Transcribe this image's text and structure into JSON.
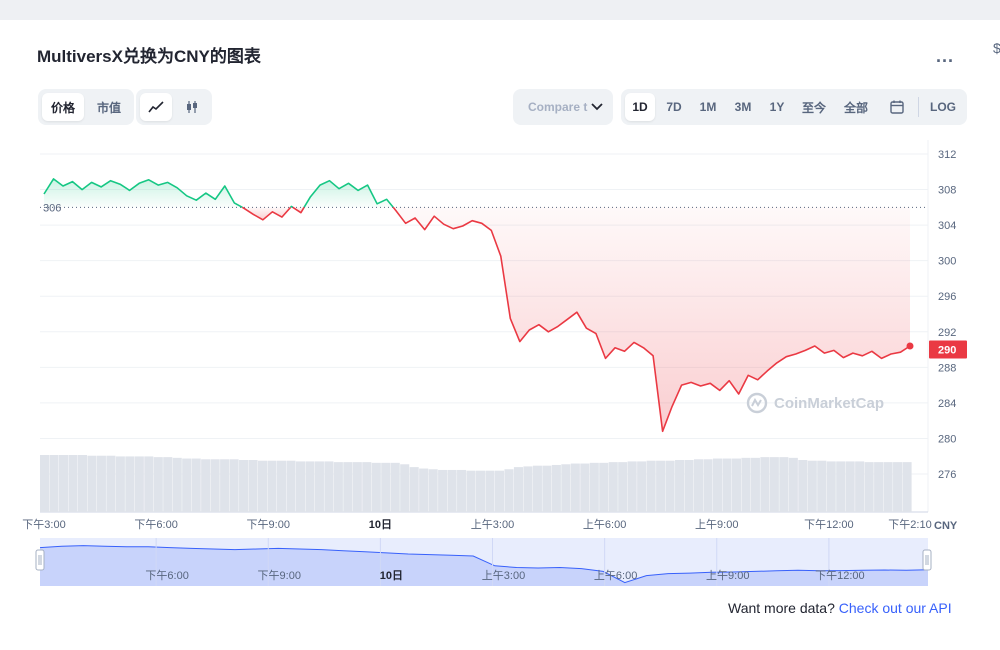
{
  "header": {
    "title": "MultiversX兑换为CNY的图表",
    "more_label": "...",
    "edge_char": "$"
  },
  "toolbar": {
    "view_tabs": [
      "价格",
      "市值"
    ],
    "chart_style": [
      "line-icon",
      "candlestick-icon"
    ],
    "compare_placeholder": "Compare t",
    "ranges": [
      "1D",
      "7D",
      "1M",
      "3M",
      "1Y",
      "至今",
      "全部"
    ],
    "calendar_icon": "calendar-icon",
    "log_label": "LOG"
  },
  "colors": {
    "up": "#16c784",
    "down": "#ea3943",
    "accent": "#3861fb"
  },
  "chart_data": {
    "type": "line",
    "currency_label": "CNY",
    "reference_line_value": 306,
    "last_value_label": "290",
    "ylim": [
      272,
      314
    ],
    "y_ticks": [
      312,
      308,
      304,
      300,
      296,
      292,
      288,
      284,
      280,
      276
    ],
    "x_ticks": [
      "下午3:00",
      "下午6:00",
      "下午9:00",
      "10日",
      "上午3:00",
      "上午6:00",
      "上午9:00",
      "下午12:00",
      "下午2:10"
    ],
    "navigator_ticks": [
      "下午6:00",
      "下午9:00",
      "10日",
      "上午3:00",
      "上午6:00",
      "上午9:00",
      "下午12:00"
    ],
    "x_hours": [
      0,
      3,
      6,
      9,
      12,
      15,
      18,
      21,
      23.17
    ],
    "series": [
      {
        "values": [
          307.5,
          309.2,
          308.4,
          308.9,
          308.0,
          308.8,
          308.3,
          309.0,
          308.6,
          307.9,
          308.7,
          309.1,
          308.5,
          308.8,
          308.2,
          307.3,
          306.8,
          307.6,
          306.9,
          308.4,
          306.5,
          305.9,
          305.2,
          304.6,
          305.5,
          304.9,
          306.1,
          305.4,
          307.2,
          308.5,
          309.0,
          308.1,
          308.7,
          307.9,
          308.5,
          306.4,
          306.9,
          305.6,
          304.2,
          304.8,
          303.5,
          305.0,
          304.1,
          303.6,
          303.9,
          304.5,
          304.2,
          303.4,
          300.5,
          293.5,
          290.9,
          292.2,
          292.8,
          292.0,
          292.6,
          293.4,
          294.2,
          292.4,
          291.8,
          289.0,
          290.2,
          289.8,
          290.8,
          290.2,
          289.3,
          280.8,
          283.6,
          286.0,
          286.3,
          285.9,
          286.2,
          285.4,
          286.5,
          285.0,
          287.1,
          286.6,
          287.6,
          288.5,
          289.2,
          289.5,
          289.9,
          290.4,
          289.6,
          289.9,
          289.1,
          289.6,
          289.3,
          289.8,
          289.0,
          289.5,
          289.7,
          290.4
        ]
      }
    ],
    "volume": [
      0.8,
      0.8,
      0.8,
      0.8,
      0.8,
      0.79,
      0.79,
      0.79,
      0.78,
      0.78,
      0.78,
      0.78,
      0.77,
      0.77,
      0.76,
      0.75,
      0.75,
      0.74,
      0.74,
      0.74,
      0.74,
      0.73,
      0.73,
      0.72,
      0.72,
      0.72,
      0.72,
      0.71,
      0.71,
      0.71,
      0.71,
      0.7,
      0.7,
      0.7,
      0.7,
      0.69,
      0.69,
      0.69,
      0.67,
      0.63,
      0.61,
      0.6,
      0.59,
      0.59,
      0.59,
      0.58,
      0.58,
      0.58,
      0.58,
      0.6,
      0.63,
      0.64,
      0.65,
      0.65,
      0.66,
      0.67,
      0.68,
      0.68,
      0.69,
      0.69,
      0.7,
      0.7,
      0.71,
      0.71,
      0.72,
      0.72,
      0.72,
      0.73,
      0.73,
      0.74,
      0.74,
      0.75,
      0.75,
      0.75,
      0.76,
      0.76,
      0.77,
      0.77,
      0.77,
      0.76,
      0.73,
      0.72,
      0.72,
      0.71,
      0.71,
      0.71,
      0.71,
      0.7,
      0.7,
      0.7,
      0.7,
      0.7
    ],
    "navigator": [
      0.55,
      0.6,
      0.62,
      0.6,
      0.58,
      0.58,
      0.55,
      0.52,
      0.5,
      0.48,
      0.5,
      0.52,
      0.5,
      0.48,
      0.44,
      0.4,
      0.36,
      0.32,
      0.3,
      0.28,
      0.25,
      -0.1,
      -0.16,
      -0.18,
      -0.16,
      -0.2,
      -0.3,
      -0.7,
      -0.45,
      -0.38,
      -0.36,
      -0.33,
      -0.32,
      -0.3,
      -0.28,
      -0.26,
      -0.28,
      -0.27,
      -0.26,
      -0.25,
      -0.26,
      -0.24
    ]
  },
  "watermark": "CoinMarketCap",
  "footer": {
    "prompt": "Want more data?",
    "link": "Check out our API"
  }
}
